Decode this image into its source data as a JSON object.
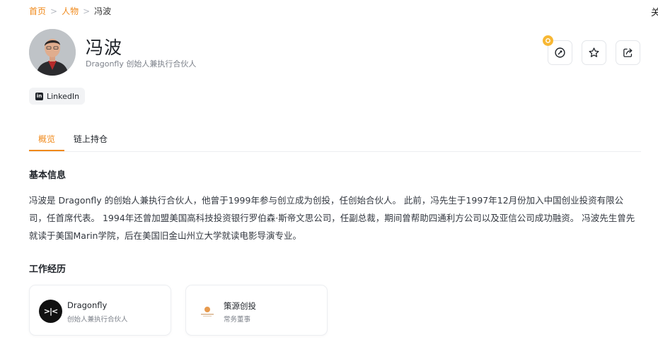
{
  "breadcrumb": {
    "home": "首页",
    "category": "人物",
    "current": "冯波",
    "separator": ">"
  },
  "edge_text": "关",
  "profile": {
    "name": "冯波",
    "subtitle": "Dragonfly 创始人兼执行合伙人",
    "linkedin_label": "LinkedIn"
  },
  "actions": [
    {
      "name": "edit",
      "icon": "edit-icon"
    },
    {
      "name": "favorite",
      "icon": "star-icon"
    },
    {
      "name": "share",
      "icon": "share-icon"
    }
  ],
  "tabs": [
    {
      "label": "概览",
      "active": true
    },
    {
      "label": "链上持仓",
      "active": false
    }
  ],
  "basic_info": {
    "title": "基本信息",
    "text": "冯波是 Dragonfly 的创始人兼执行合伙人，他曾于1999年参与创立成为创投，任创始合伙人。 此前，冯先生于1997年12月份加入中国创业投资有限公司，任首席代表。 1994年还曾加盟美国高科技投资银行罗伯森·斯帝文思公司，任副总裁，期间曾帮助四通利方公司以及亚信公司成功融资。 冯波先生曾先就读于美国Marin学院，后在美国旧金山州立大学就读电影导演专业。"
  },
  "work_history": {
    "title": "工作经历",
    "items": [
      {
        "company": "Dragonfly",
        "role": "创始人兼执行合伙人",
        "logo_text": ">|<"
      },
      {
        "company": "策源创投",
        "role": "常务董事"
      }
    ]
  },
  "colors": {
    "accent": "#f0891a",
    "badge": "#f7b733",
    "text": "#1f2329",
    "muted": "#7c818a"
  }
}
